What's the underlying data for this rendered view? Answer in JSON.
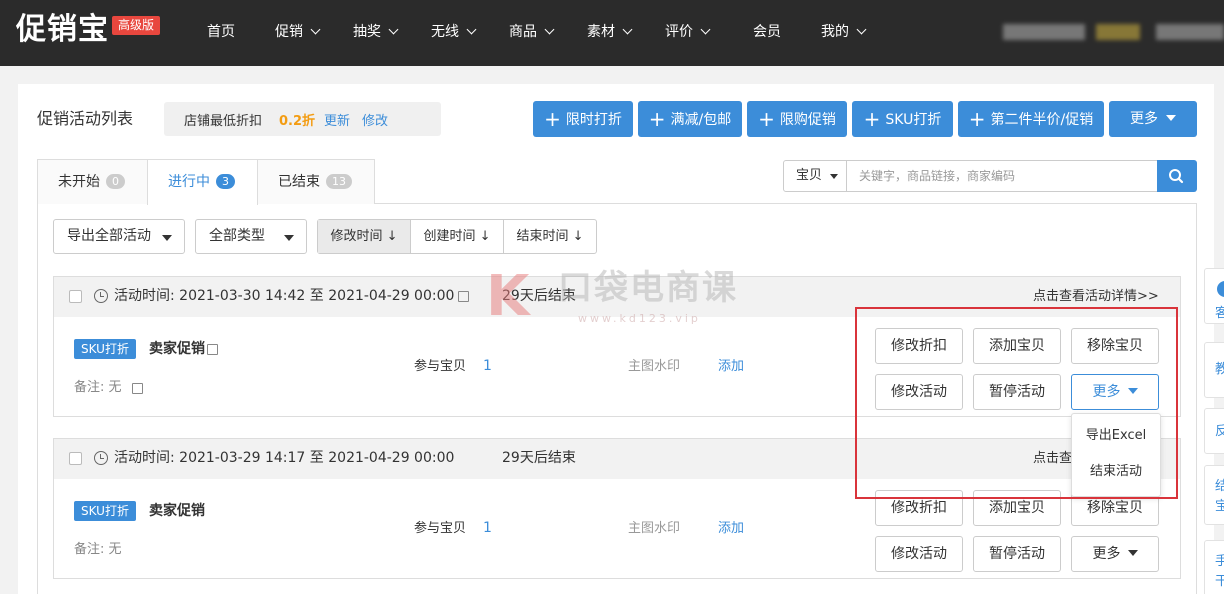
{
  "brand": {
    "logo": "促销宝",
    "badge": "高级版"
  },
  "nav": [
    {
      "label": "首页",
      "dropdown": false
    },
    {
      "label": "促销",
      "dropdown": true
    },
    {
      "label": "抽奖",
      "dropdown": true
    },
    {
      "label": "无线",
      "dropdown": true
    },
    {
      "label": "商品",
      "dropdown": true
    },
    {
      "label": "素材",
      "dropdown": true
    },
    {
      "label": "评价",
      "dropdown": true
    },
    {
      "label": "会员",
      "dropdown": false
    },
    {
      "label": "我的",
      "dropdown": true
    }
  ],
  "page": {
    "title": "促销活动列表",
    "min_discount_label": "店铺最低折扣",
    "min_discount_value": "0.2折",
    "update_link": "更新",
    "modify_link": "修改"
  },
  "create_buttons": [
    "限时打折",
    "满减/包邮",
    "限购促销",
    "SKU打折",
    "第二件半价/促销"
  ],
  "more_button": "更多",
  "tabs": [
    {
      "label": "未开始",
      "count": "0"
    },
    {
      "label": "进行中",
      "count": "3"
    },
    {
      "label": "已结束",
      "count": "13"
    }
  ],
  "search": {
    "scope": "宝贝",
    "placeholder": "关键字，商品链接，商家编码"
  },
  "filters": {
    "export_all": "导出全部活动",
    "type": "全部类型"
  },
  "sort": [
    "修改时间",
    "创建时间",
    "结束时间"
  ],
  "sort_arrow": "↓",
  "activities": [
    {
      "time_label": "活动时间:",
      "start": "2021-03-30 14:42",
      "to": "至",
      "end": "2021-04-29 00:00",
      "remaining": "29天后结束",
      "detail_link": "点击查看活动详情>>",
      "tag": "SKU打折",
      "name": "卖家促销",
      "note": "备注: 无",
      "items_label": "参与宝贝",
      "items_count": "1",
      "watermark_label": "主图水印",
      "watermark_add": "添加",
      "buttons": [
        "修改折扣",
        "添加宝贝",
        "移除宝贝",
        "修改活动",
        "暂停活动",
        "更多"
      ]
    },
    {
      "time_label": "活动时间:",
      "start": "2021-03-29 14:17",
      "to": "至",
      "end": "2021-04-29 00:00",
      "remaining": "29天后结束",
      "detail_link": "点击查",
      "tag": "SKU打折",
      "name": "卖家促销",
      "note": "备注: 无",
      "items_label": "参与宝贝",
      "items_count": "1",
      "watermark_label": "主图水印",
      "watermark_add": "添加",
      "buttons": [
        "修改折扣",
        "添加宝贝",
        "移除宝贝",
        "修改活动",
        "暂停活动",
        "更多"
      ]
    }
  ],
  "dropdown_menu": [
    "导出Excel",
    "结束活动"
  ],
  "watermark": {
    "text": "口袋电商课",
    "url": "www.kd123.vip"
  },
  "side_panel": [
    "客",
    "教",
    "反",
    "结",
    "宝",
    "手",
    "干"
  ],
  "colors": {
    "accent": "#3c8dd9",
    "topbar": "#2b2b2b",
    "orange": "#f39c12",
    "highlight_red": "#d9343b"
  }
}
